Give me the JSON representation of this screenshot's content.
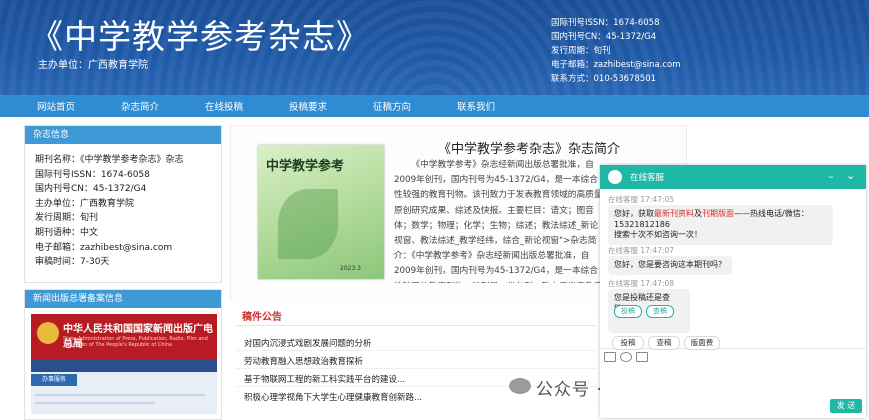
{
  "header": {
    "title": "《中学教学参考杂志》",
    "sponsor": "主办单位：广西教育学院",
    "info": [
      "国际刊号ISSN：1674-6058",
      "国内刊号CN：45-1372/G4",
      "发行周期：旬刊",
      "电子邮箱：zazhibest@sina.com",
      "联系方式：010-53678501"
    ]
  },
  "nav": {
    "items": [
      "网站首页",
      "杂志简介",
      "在线投稿",
      "投稿要求",
      "征稿方向",
      "联系我们"
    ]
  },
  "sidebar": {
    "info_title": "杂志信息",
    "info_rows": [
      "期刊名称：《中学教学参考杂志》杂志",
      "国际刊号ISSN：1674-6058",
      "国内刊号CN：45-1372/G4",
      "主办单位：广西教育学院",
      "发行周期：旬刊",
      "期刊语种：中文",
      "电子邮箱：zazhibest@sina.com",
      "审稿时间：7-30天"
    ],
    "gov_title": "新闻出版总署备案信息",
    "gov_banner": "中华人民共和国国家新闻出版广电总局",
    "gov_sub": "State Administration of Press, Publication, Radio, Film and Television of The People's Republic of China",
    "gov_badge": "办事服务"
  },
  "intro": {
    "title": "《中学教学参考杂志》杂志简介",
    "cover_title": "中学教学参考",
    "cover_year": "2023.3",
    "text": "《中学教学参考》杂志经新闻出版总署批准，自2009年创刊，国内刊号为45-1372/G4，是一本综合性较强的教育刊物。该刊致力于发表教育领域的高质量原创研究成果、综述及快报。主要栏目：语文；图音体；数学；物理；化学；生物；综述；教法综述_新论视窗、教法综述_教学经纬，综合_新论视窗\">杂志简介：《中学教学参考》杂志经新闻出版总署批准，自2009年创刊，国内刊号为45-1372/G4，是一本综合性较强的教育刊物。该刊是一份旬刊，致力于发表教育领域的高质量原创研究成果、综述及快报。主要栏目：语文、图音体、数学、物理；教法综述_新论视窗、教法综述_教学经纬、综合_新论视窗"
  },
  "notice": {
    "title": "稿件公告",
    "items": [
      "对国内沉浸式戏剧发展问题的分析",
      "劳动教育融入思想政治教育探析",
      "基于物联网工程的新工科实践平台的建设...",
      "积极心理学视角下大学生心理健康教育创新路..."
    ]
  },
  "watermark": "公众号 · 中学教学参考期刊",
  "chat": {
    "title": "在线客服",
    "messages": [
      {
        "meta": "在线客服  17:47:05",
        "lines": [
          "您好，获取最新刊资料及刊期版面——热线电话/微信：",
          "15321812186",
          "搜索十次不如咨询一次！"
        ]
      },
      {
        "meta": "在线客服  17:47:07",
        "lines": [
          "您好，您是要咨询这本期刊吗？"
        ]
      },
      {
        "meta": "在线客服  17:47:08",
        "lines": [
          "您是投稿还是查稿？"
        ]
      }
    ],
    "hl_text": "最新刊资料",
    "hl_text2": "刊期版面",
    "quick_replies": [
      "投稿",
      "查稿"
    ],
    "options": [
      "投稿",
      "查稿",
      "版面费"
    ],
    "send_label": "发 送"
  }
}
